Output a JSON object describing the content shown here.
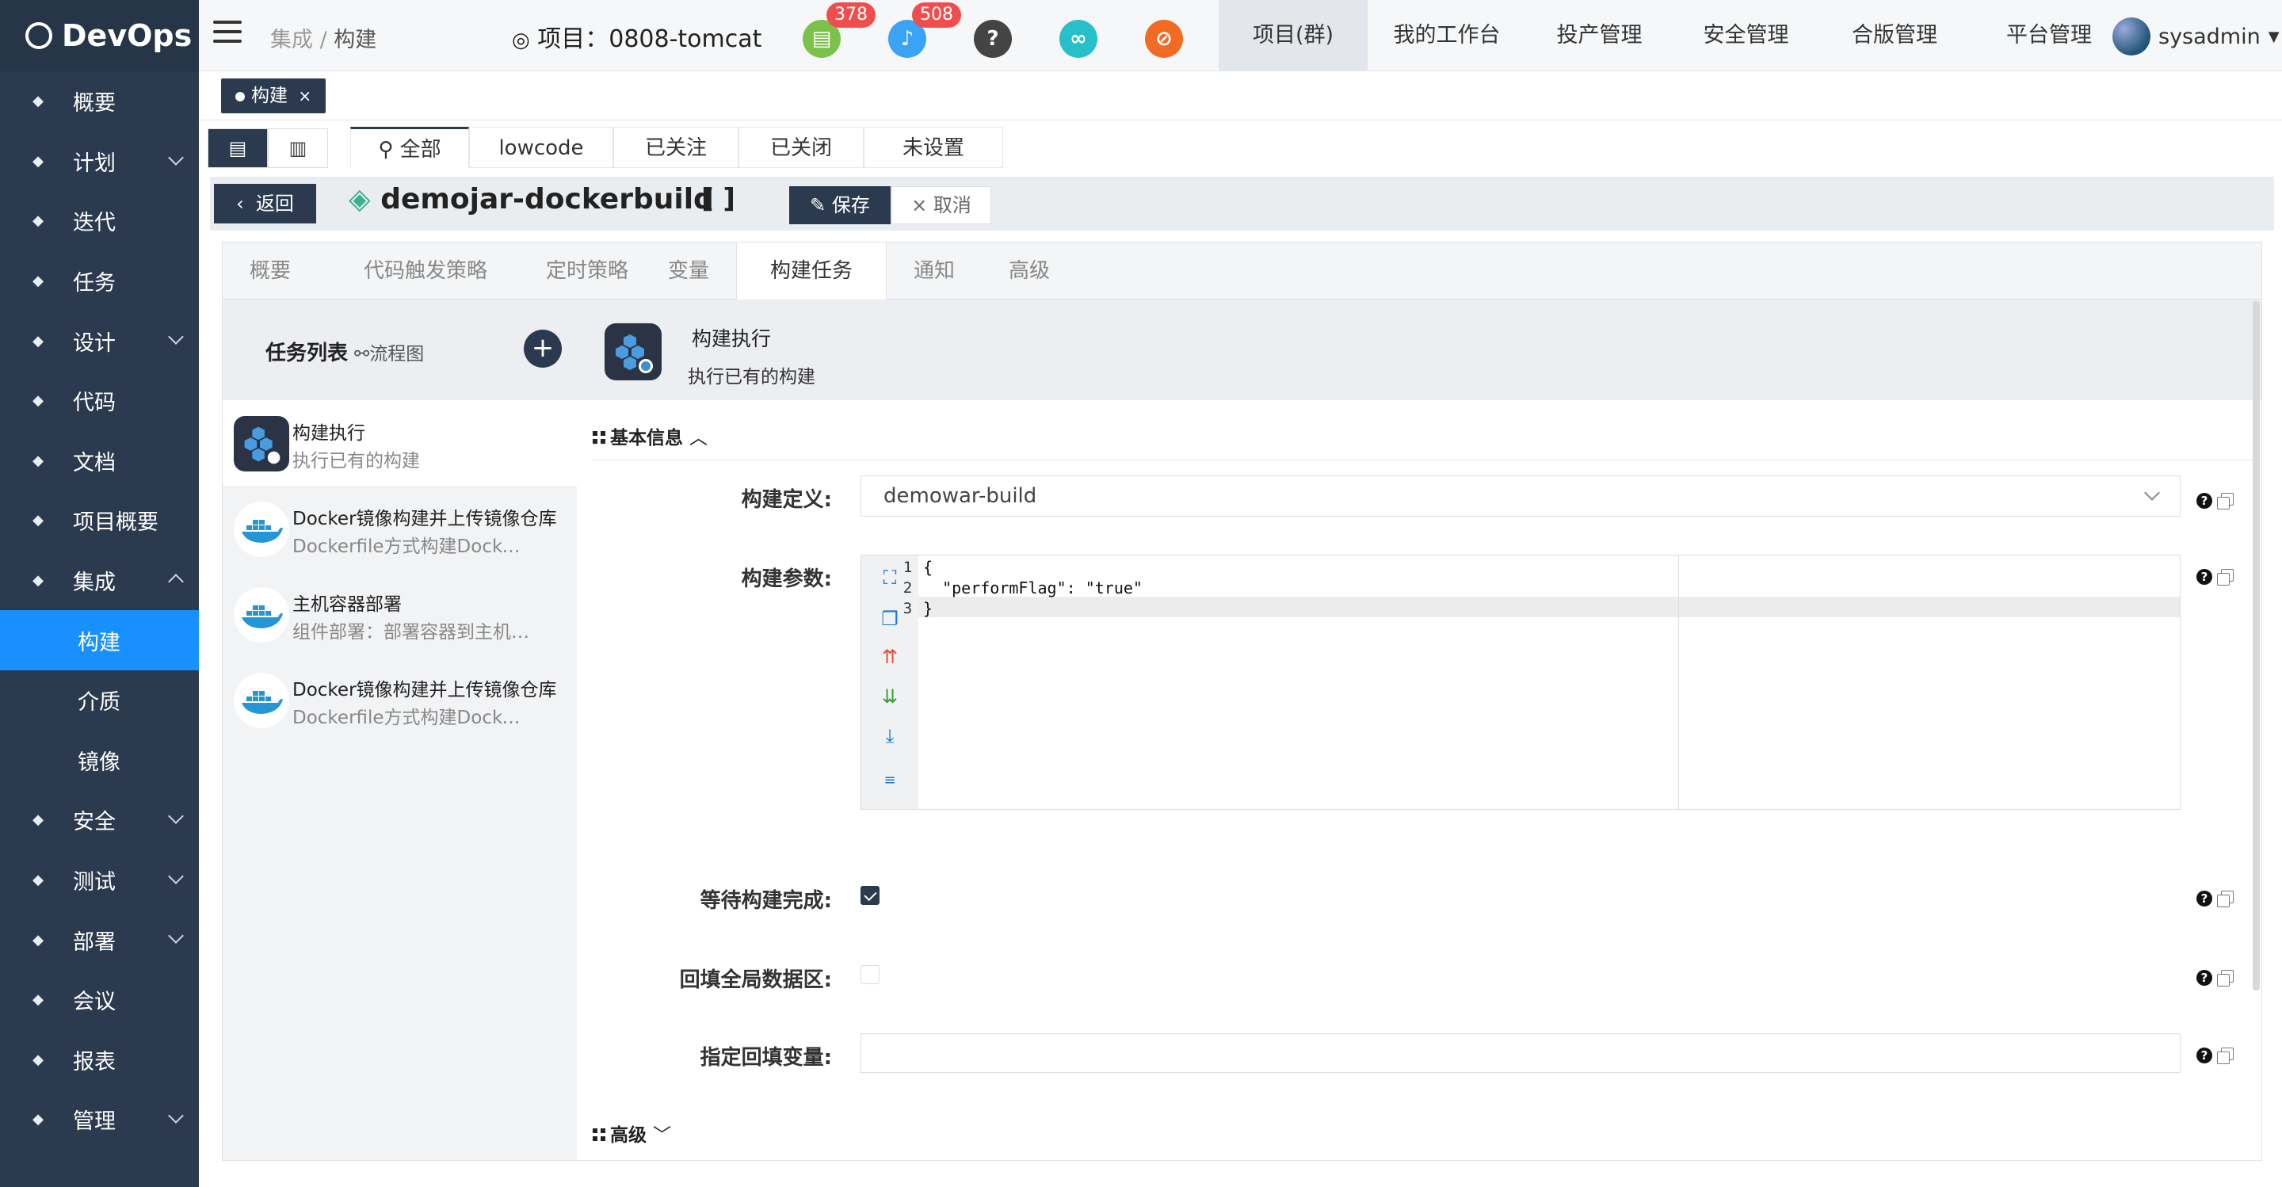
{
  "app": {
    "name": "DevOps"
  },
  "sidebar": {
    "items": [
      {
        "label": "概要",
        "icon": "dashboard-icon"
      },
      {
        "label": "计划",
        "icon": "plan-icon",
        "expandable": true
      },
      {
        "label": "迭代",
        "icon": "iteration-icon"
      },
      {
        "label": "任务",
        "icon": "task-icon"
      },
      {
        "label": "设计",
        "icon": "design-icon",
        "expandable": true
      },
      {
        "label": "代码",
        "icon": "code-icon"
      },
      {
        "label": "文档",
        "icon": "document-icon"
      },
      {
        "label": "项目概要",
        "icon": "project-summary-icon"
      },
      {
        "label": "集成",
        "icon": "integration-icon",
        "expanded": true
      },
      {
        "label": "构建",
        "sub": true,
        "active": true
      },
      {
        "label": "介质",
        "sub": true
      },
      {
        "label": "镜像",
        "sub": true
      },
      {
        "label": "安全",
        "icon": "shield-icon",
        "expandable": true
      },
      {
        "label": "测试",
        "icon": "flask-icon",
        "expandable": true
      },
      {
        "label": "部署",
        "icon": "deploy-icon",
        "expandable": true
      },
      {
        "label": "会议",
        "icon": "meeting-icon"
      },
      {
        "label": "报表",
        "icon": "report-icon"
      },
      {
        "label": "管理",
        "icon": "gear-icon",
        "expandable": true
      }
    ]
  },
  "topbar": {
    "breadcrumb": {
      "parent": "集成",
      "sep": "/",
      "current": "构建"
    },
    "project_label": "项目：0808-tomcat",
    "badges": {
      "docs": "378",
      "notifications": "508"
    },
    "menu": [
      "项目(群)",
      "我的工作台",
      "投产管理",
      "安全管理",
      "合版管理",
      "平台管理"
    ],
    "user": "sysadmin"
  },
  "tagbar": {
    "tag": "构建",
    "close": "×"
  },
  "filter_tabs": [
    "全部",
    "lowcode",
    "已关注",
    "已关闭",
    "未设置"
  ],
  "titlebar": {
    "back": "返回",
    "pipeline_name": "demojar-dockerbuild",
    "bracket": "[ ]",
    "save": "保存",
    "cancel": "取消"
  },
  "section_tabs": [
    "概要",
    "代码触发策略",
    "定时策略",
    "变量",
    "构建任务",
    "通知",
    "高级"
  ],
  "task_list": {
    "title": "任务列表",
    "subtitle": "流程图",
    "add": "+",
    "tasks": [
      {
        "name": "构建执行",
        "desc": "执行已有的构建"
      },
      {
        "name": "Docker镜像构建并上传镜像仓库",
        "desc": "Dockerfile方式构建Docker镜像"
      },
      {
        "name": "主机容器部署",
        "desc": "组件部署：部署容器到主机环境"
      },
      {
        "name": "Docker镜像构建并上传镜像仓库",
        "desc": "Dockerfile方式构建Docker镜像"
      }
    ]
  },
  "detail": {
    "name": "构建执行",
    "desc": "执行已有的构建",
    "basic_section": "基本信息",
    "advanced_section": "高级",
    "fields": {
      "build_def_label": "构建定义:",
      "build_def_value": "demowar-build",
      "params_label": "构建参数:",
      "params_lines": [
        "{",
        "  \"performFlag\": \"true\"",
        "}"
      ],
      "line_numbers": [
        "1",
        "2",
        "3"
      ],
      "wait_label": "等待构建完成:",
      "wait_checked": true,
      "backfill_label": "回填全局数据区:",
      "backfill_checked": false,
      "var_label": "指定回填变量:",
      "var_value": ""
    },
    "help": "?"
  }
}
